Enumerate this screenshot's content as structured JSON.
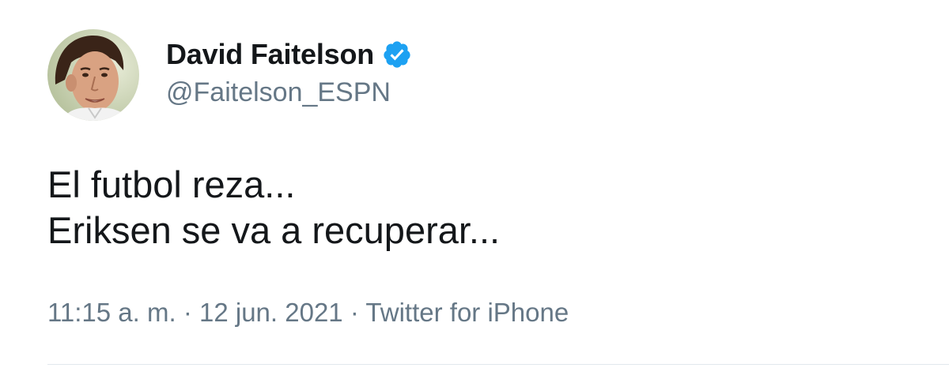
{
  "author": {
    "display_name": "David Faitelson",
    "handle": "@Faitelson_ESPN",
    "verified": true,
    "avatar_icon": "profile-photo",
    "verified_icon": "verified-badge-icon",
    "verified_color": "#1da1f2"
  },
  "tweet": {
    "lines": [
      "El futbol reza...",
      "Eriksen se va a recuperar..."
    ]
  },
  "meta": {
    "time": "11:15 a. m.",
    "separator": "·",
    "date": "12 jun. 2021",
    "source": "Twitter for iPhone"
  },
  "colors": {
    "text_primary": "#14171a",
    "text_secondary": "#657786",
    "divider": "#e1e8ed"
  }
}
